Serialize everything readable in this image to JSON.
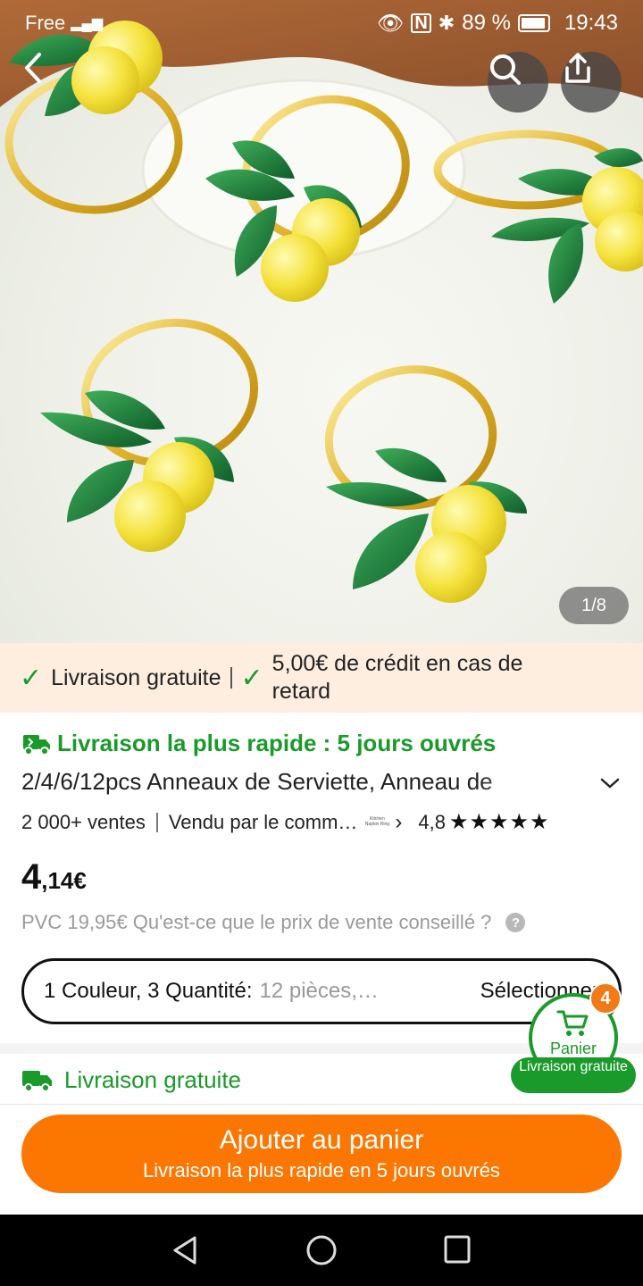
{
  "status_bar": {
    "carrier": "Free",
    "battery": "89 %",
    "time": "19:43"
  },
  "hero": {
    "page_indicator": "1/8",
    "icons": [
      "back-arrow-icon",
      "search-icon",
      "share-icon"
    ]
  },
  "promo": {
    "item1": "Livraison gratuite",
    "item2": "5,00€ de crédit en cas de retard"
  },
  "product": {
    "fast_delivery": "Livraison la plus rapide : 5 jours ouvrés",
    "title": "2/4/6/12pcs Anneaux de Serviette, Anneau de",
    "sales": "2 000+ ventes",
    "seller": "Vendu par le comm…",
    "seller_logo": "Kitchen Napkin Ring",
    "rating": "4,8",
    "stars": "★★★★★",
    "price_int": "4",
    "price_dec": ",14€",
    "pvc_text": "PVC 19,95€ Qu'est-ce que le prix de vente conseillé ?",
    "variant_label": "1 Couleur, 3 Quantité:",
    "variant_value": "12 pièces,…",
    "variant_select": "Sélectionner"
  },
  "shipping": {
    "label": "Livraison gratuite"
  },
  "cart": {
    "badge": "4",
    "label": "Panier",
    "pill": "Livraison gratuite"
  },
  "add_to_cart": {
    "label": "Ajouter au panier",
    "sub": "Livraison la plus rapide en 5 jours ouvrés"
  },
  "colors": {
    "accent_orange": "#fb7701",
    "green": "#1a9a2a",
    "promo_bg": "#fdeee0"
  }
}
